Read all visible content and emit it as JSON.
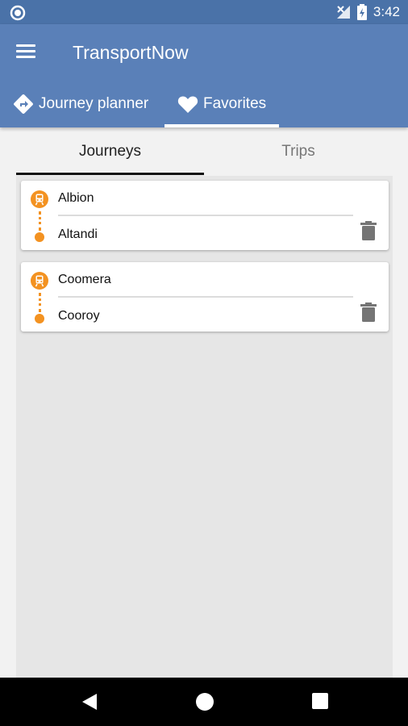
{
  "status_bar": {
    "time": "3:42"
  },
  "app": {
    "title": "TransportNow"
  },
  "nav_tabs": [
    {
      "label": "Journey planner",
      "icon": "directions-icon"
    },
    {
      "label": "Favorites",
      "icon": "heart-icon"
    }
  ],
  "sub_tabs": [
    {
      "label": "Journeys",
      "selected": true
    },
    {
      "label": "Trips",
      "selected": false
    }
  ],
  "journeys": [
    {
      "from": "Albion",
      "to": "Altandi"
    },
    {
      "from": "Coomera",
      "to": "Cooroy"
    }
  ],
  "colors": {
    "primary": "#5a80b8",
    "status_bar": "#4a72a8",
    "accent": "#f39221"
  }
}
